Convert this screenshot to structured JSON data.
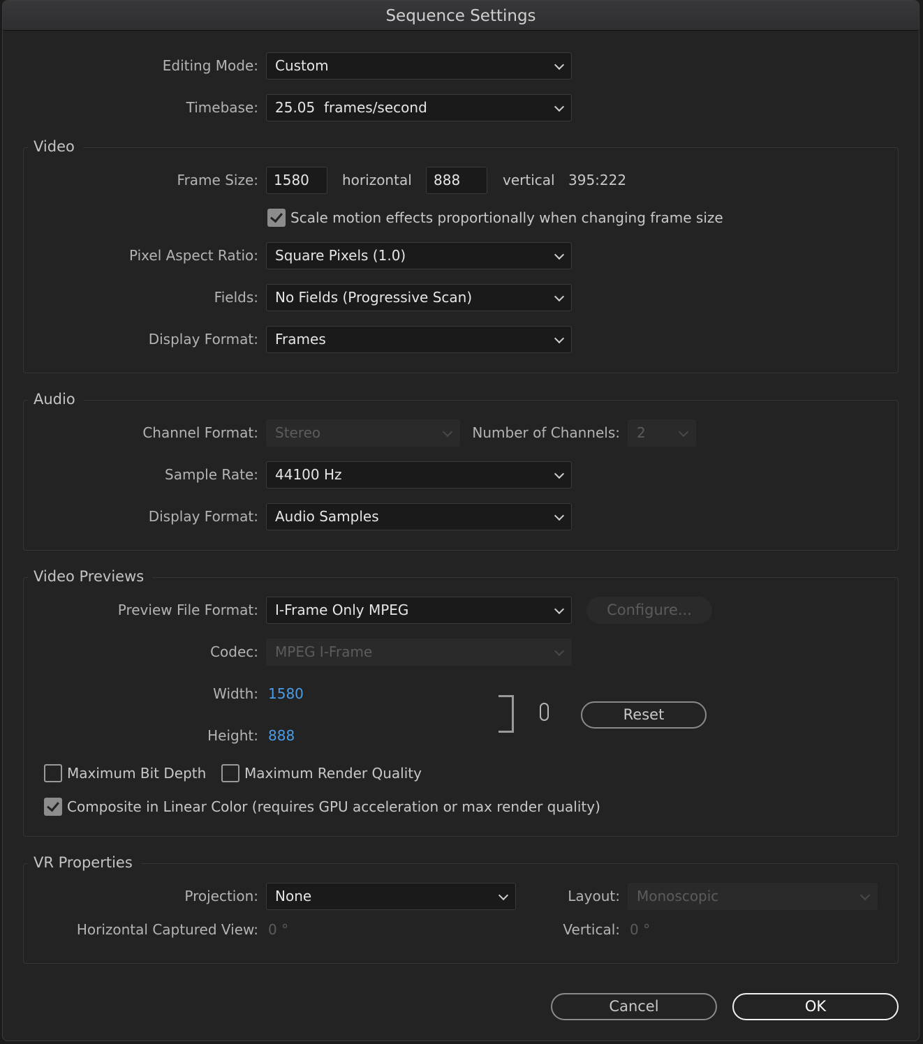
{
  "title": "Sequence Settings",
  "editing_mode": {
    "label": "Editing Mode:",
    "value": "Custom"
  },
  "timebase": {
    "label": "Timebase:",
    "value": "25.05  frames/second"
  },
  "video": {
    "legend": "Video",
    "frame_size_label": "Frame Size:",
    "width": "1580",
    "horizontal": "horizontal",
    "height": "888",
    "vertical": "vertical",
    "ratio": "395:222",
    "scale_checkbox": {
      "label": "Scale motion effects proportionally when changing frame size",
      "checked": true
    },
    "par": {
      "label": "Pixel Aspect Ratio:",
      "value": "Square Pixels (1.0)"
    },
    "fields": {
      "label": "Fields:",
      "value": "No Fields (Progressive Scan)"
    },
    "display_format": {
      "label": "Display Format:",
      "value": "Frames"
    }
  },
  "audio": {
    "legend": "Audio",
    "channel_format": {
      "label": "Channel Format:",
      "value": "Stereo"
    },
    "num_channels": {
      "label": "Number of Channels:",
      "value": "2"
    },
    "sample_rate": {
      "label": "Sample Rate:",
      "value": "44100 Hz"
    },
    "display_format": {
      "label": "Display Format:",
      "value": "Audio Samples"
    }
  },
  "previews": {
    "legend": "Video Previews",
    "file_format": {
      "label": "Preview File Format:",
      "value": "I-Frame Only MPEG"
    },
    "configure": "Configure...",
    "codec": {
      "label": "Codec:",
      "value": "MPEG I-Frame"
    },
    "width": {
      "label": "Width:",
      "value": "1580"
    },
    "height": {
      "label": "Height:",
      "value": "888"
    },
    "reset": "Reset",
    "max_bit_depth": {
      "label": "Maximum Bit Depth",
      "checked": false
    },
    "max_render_quality": {
      "label": "Maximum Render Quality",
      "checked": false
    },
    "linear_color": {
      "label": "Composite in Linear Color (requires GPU acceleration or max render quality)",
      "checked": true
    }
  },
  "vr": {
    "legend": "VR Properties",
    "projection": {
      "label": "Projection:",
      "value": "None"
    },
    "layout": {
      "label": "Layout:",
      "value": "Monoscopic"
    },
    "hcv": {
      "label": "Horizontal Captured View:",
      "value": "0 °"
    },
    "vertical": {
      "label": "Vertical:",
      "value": "0 °"
    }
  },
  "buttons": {
    "cancel": "Cancel",
    "ok": "OK"
  }
}
